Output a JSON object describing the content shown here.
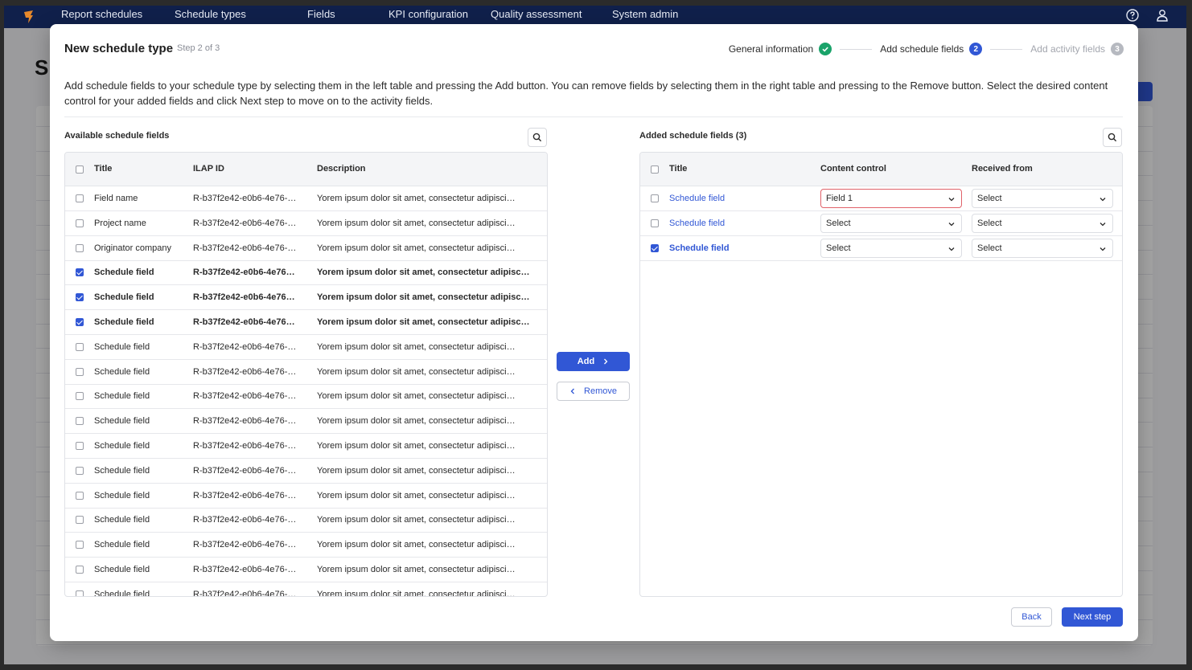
{
  "nav": {
    "items": [
      "Report schedules",
      "Schedule types",
      "Fields",
      "KPI configuration",
      "Quality assessment",
      "System admin"
    ]
  },
  "background": {
    "heading": "S"
  },
  "modal": {
    "title": "New schedule type",
    "step_text": "Step 2 of 3",
    "stepper": {
      "step1": "General information",
      "step2": "Add schedule fields",
      "step2_num": "2",
      "step3": "Add activity fields",
      "step3_num": "3"
    },
    "description": "Add schedule fields to your schedule type by selecting them in the left table and pressing the Add button. You can remove fields by selecting them in the right table and pressing to the Remove button. Select the desired content control for your added fields and click Next step to move on to the activity fields.",
    "left": {
      "title": "Available schedule fields",
      "columns": [
        "Title",
        "ILAP ID",
        "Description"
      ],
      "rows": [
        {
          "title": "Field name",
          "id": "R-b37f2e42-e0b6-4e76-…",
          "desc": "Yorem ipsum dolor sit amet, consectetur adipisci…",
          "checked": false
        },
        {
          "title": "Project name",
          "id": "R-b37f2e42-e0b6-4e76-…",
          "desc": "Yorem ipsum dolor sit amet, consectetur adipisci…",
          "checked": false
        },
        {
          "title": "Originator company",
          "id": "R-b37f2e42-e0b6-4e76-…",
          "desc": "Yorem ipsum dolor sit amet, consectetur adipisci…",
          "checked": false
        },
        {
          "title": "Schedule field",
          "id": "R-b37f2e42-e0b6-4e76…",
          "desc": "Yorem ipsum dolor sit amet, consectetur adipisc…",
          "checked": true
        },
        {
          "title": "Schedule field",
          "id": "R-b37f2e42-e0b6-4e76…",
          "desc": "Yorem ipsum dolor sit amet, consectetur adipisc…",
          "checked": true
        },
        {
          "title": "Schedule field",
          "id": "R-b37f2e42-e0b6-4e76…",
          "desc": "Yorem ipsum dolor sit amet, consectetur adipisc…",
          "checked": true
        },
        {
          "title": "Schedule field",
          "id": "R-b37f2e42-e0b6-4e76-…",
          "desc": "Yorem ipsum dolor sit amet, consectetur adipisci…",
          "checked": false
        },
        {
          "title": "Schedule field",
          "id": "R-b37f2e42-e0b6-4e76-…",
          "desc": "Yorem ipsum dolor sit amet, consectetur adipisci…",
          "checked": false
        },
        {
          "title": "Schedule field",
          "id": "R-b37f2e42-e0b6-4e76-…",
          "desc": "Yorem ipsum dolor sit amet, consectetur adipisci…",
          "checked": false
        },
        {
          "title": "Schedule field",
          "id": "R-b37f2e42-e0b6-4e76-…",
          "desc": "Yorem ipsum dolor sit amet, consectetur adipisci…",
          "checked": false
        },
        {
          "title": "Schedule field",
          "id": "R-b37f2e42-e0b6-4e76-…",
          "desc": "Yorem ipsum dolor sit amet, consectetur adipisci…",
          "checked": false
        },
        {
          "title": "Schedule field",
          "id": "R-b37f2e42-e0b6-4e76-…",
          "desc": "Yorem ipsum dolor sit amet, consectetur adipisci…",
          "checked": false
        },
        {
          "title": "Schedule field",
          "id": "R-b37f2e42-e0b6-4e76-…",
          "desc": "Yorem ipsum dolor sit amet, consectetur adipisci…",
          "checked": false
        },
        {
          "title": "Schedule field",
          "id": "R-b37f2e42-e0b6-4e76-…",
          "desc": "Yorem ipsum dolor sit amet, consectetur adipisci…",
          "checked": false
        },
        {
          "title": "Schedule field",
          "id": "R-b37f2e42-e0b6-4e76-…",
          "desc": "Yorem ipsum dolor sit amet, consectetur adipisci…",
          "checked": false
        },
        {
          "title": "Schedule field",
          "id": "R-b37f2e42-e0b6-4e76-…",
          "desc": "Yorem ipsum dolor sit amet, consectetur adipisci…",
          "checked": false
        },
        {
          "title": "Schedule field",
          "id": "R-b37f2e42-e0b6-4e76-…",
          "desc": "Yorem ipsum dolor sit amet, consectetur adipisci…",
          "checked": false
        }
      ]
    },
    "right": {
      "title": "Added schedule fields (3)",
      "columns": [
        "Title",
        "Content control",
        "Received from"
      ],
      "rows": [
        {
          "title": "Schedule field",
          "content": "Field 1",
          "received": "Select",
          "checked": false,
          "error": true
        },
        {
          "title": "Schedule field",
          "content": "Select",
          "received": "Select",
          "checked": false,
          "error": false
        },
        {
          "title": "Schedule field",
          "content": "Select",
          "received": "Select",
          "checked": true,
          "error": false
        }
      ]
    },
    "buttons": {
      "add": "Add",
      "remove": "Remove",
      "back": "Back",
      "next": "Next step"
    }
  },
  "colors": {
    "accent": "#3157d5",
    "success": "#1aa36a",
    "nav_bg": "#10204b",
    "error": "#e0626a"
  }
}
